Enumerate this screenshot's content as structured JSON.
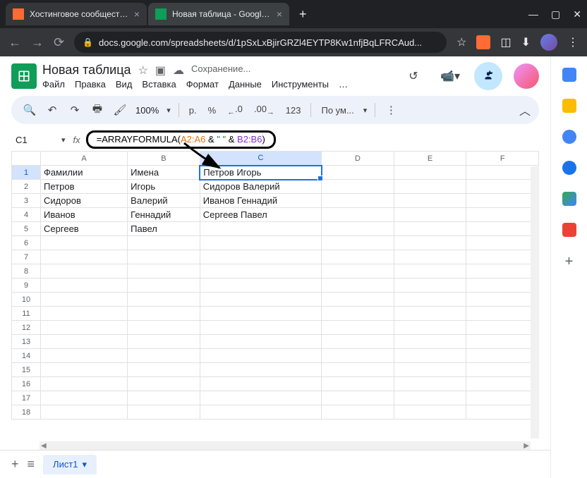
{
  "browser": {
    "tabs": [
      {
        "label": "Хостинговое сообщество «Tim"
      },
      {
        "label": "Новая таблица - Google Табли"
      }
    ],
    "url": "docs.google.com/spreadsheets/d/1pSxLxBjirGRZl4EYTP8Kw1nfjBqLFRCAud..."
  },
  "doc": {
    "title": "Новая таблица",
    "saving": "Сохранение...",
    "menus": {
      "file": "Файл",
      "edit": "Правка",
      "view": "Вид",
      "insert": "Вставка",
      "format": "Формат",
      "data": "Данные",
      "tools": "Инструменты",
      "more": "…"
    }
  },
  "toolbar": {
    "zoom": "100%",
    "currency": "р.",
    "percent": "%",
    "dec_dec": ".0",
    "dec_inc": ".00",
    "num_format": "123",
    "font": "По ум..."
  },
  "formula": {
    "cell_ref": "C1",
    "prefix": "=ARRAYFORMULA(",
    "range1": "A2:A6",
    "mid1": " & ",
    "quote": "\" \"",
    "mid2": " & ",
    "range2": "B2:B6",
    "suffix": ")"
  },
  "chart_data": {
    "type": "table",
    "columns": [
      "A",
      "B",
      "C",
      "D",
      "E",
      "F"
    ],
    "rows": [
      {
        "n": 1,
        "A": "Фамилии",
        "B": "Имена",
        "C": "Петров Игорь"
      },
      {
        "n": 2,
        "A": "Петров",
        "B": "Игорь",
        "C": "Сидоров Валерий"
      },
      {
        "n": 3,
        "A": "Сидоров",
        "B": "Валерий",
        "C": "Иванов Геннадий"
      },
      {
        "n": 4,
        "A": "Иванов",
        "B": "Геннадий",
        "C": "Сергеев Павел"
      },
      {
        "n": 5,
        "A": "Сергеев",
        "B": "Павел",
        "C": ""
      },
      {
        "n": 6
      },
      {
        "n": 7
      },
      {
        "n": 8
      },
      {
        "n": 9
      },
      {
        "n": 10
      },
      {
        "n": 11
      },
      {
        "n": 12
      },
      {
        "n": 13
      },
      {
        "n": 14
      },
      {
        "n": 15
      },
      {
        "n": 16
      },
      {
        "n": 17
      },
      {
        "n": 18
      }
    ]
  },
  "sheet_tabs": {
    "sheet1": "Лист1"
  }
}
